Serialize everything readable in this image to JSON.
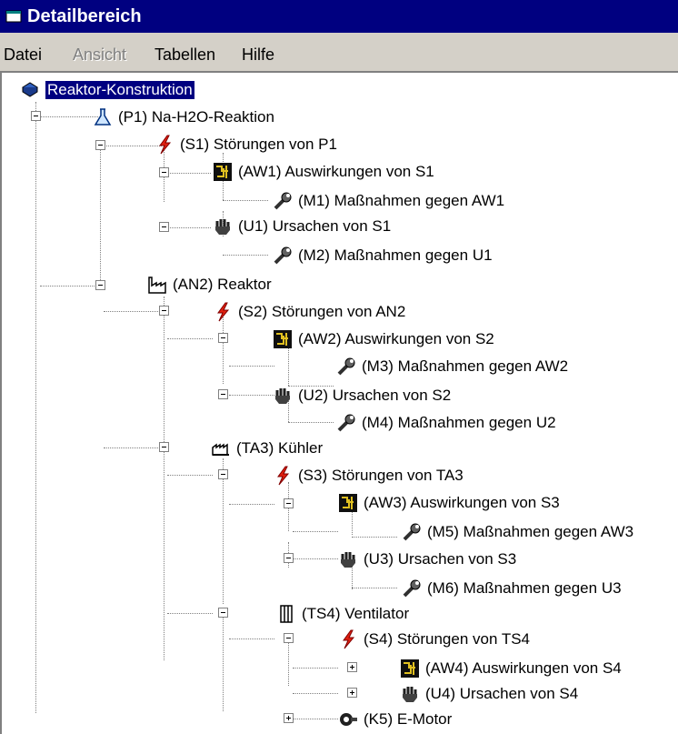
{
  "window": {
    "title": "Detailbereich"
  },
  "menu": {
    "datei": "Datei",
    "ansicht": "Ansicht",
    "tabellen": "Tabellen",
    "hilfe": "Hilfe"
  },
  "tree": {
    "root": "Reaktor-Konstruktion",
    "p1": "(P1) Na-H2O-Reaktion",
    "s1": "(S1) Störungen von P1",
    "aw1": "(AW1) Auswirkungen von S1",
    "m1": "(M1) Maßnahmen gegen AW1",
    "u1": "(U1) Ursachen von S1",
    "m2": "(M2) Maßnahmen gegen U1",
    "an2": "(AN2) Reaktor",
    "s2": "(S2) Störungen von AN2",
    "aw2": "(AW2) Auswirkungen von S2",
    "m3": "(M3) Maßnahmen gegen AW2",
    "u2": "(U2) Ursachen von S2",
    "m4": "(M4) Maßnahmen gegen U2",
    "ta3": "(TA3) Kühler",
    "s3": "(S3) Störungen von TA3",
    "aw3": "(AW3) Auswirkungen von S3",
    "m5": "(M5) Maßnahmen gegen AW3",
    "u3": "(U3) Ursachen von S3",
    "m6": "(M6) Maßnahmen gegen U3",
    "ts4": "(TS4) Ventilator",
    "s4": "(S4) Störungen von TS4",
    "aw4": "(AW4) Auswirkungen von S4",
    "u4": "(U4) Ursachen von S4",
    "k5": "(K5) E-Motor"
  },
  "colors": {
    "titlebar": "#000080",
    "selection": "#000080",
    "window_bg": "#d4d0c8",
    "tree_bg": "#ffffff"
  },
  "icons": {
    "root": "book-icon",
    "process": "flask-icon",
    "stoerung": "lightning-icon",
    "auswirkung": "circuit-icon",
    "massnahme": "wrench-icon",
    "ursache": "hand-icon",
    "anlage": "factory-icon",
    "teilanlage": "plant-icon",
    "teilsystem": "fan-icon",
    "komponente": "motor-icon"
  }
}
